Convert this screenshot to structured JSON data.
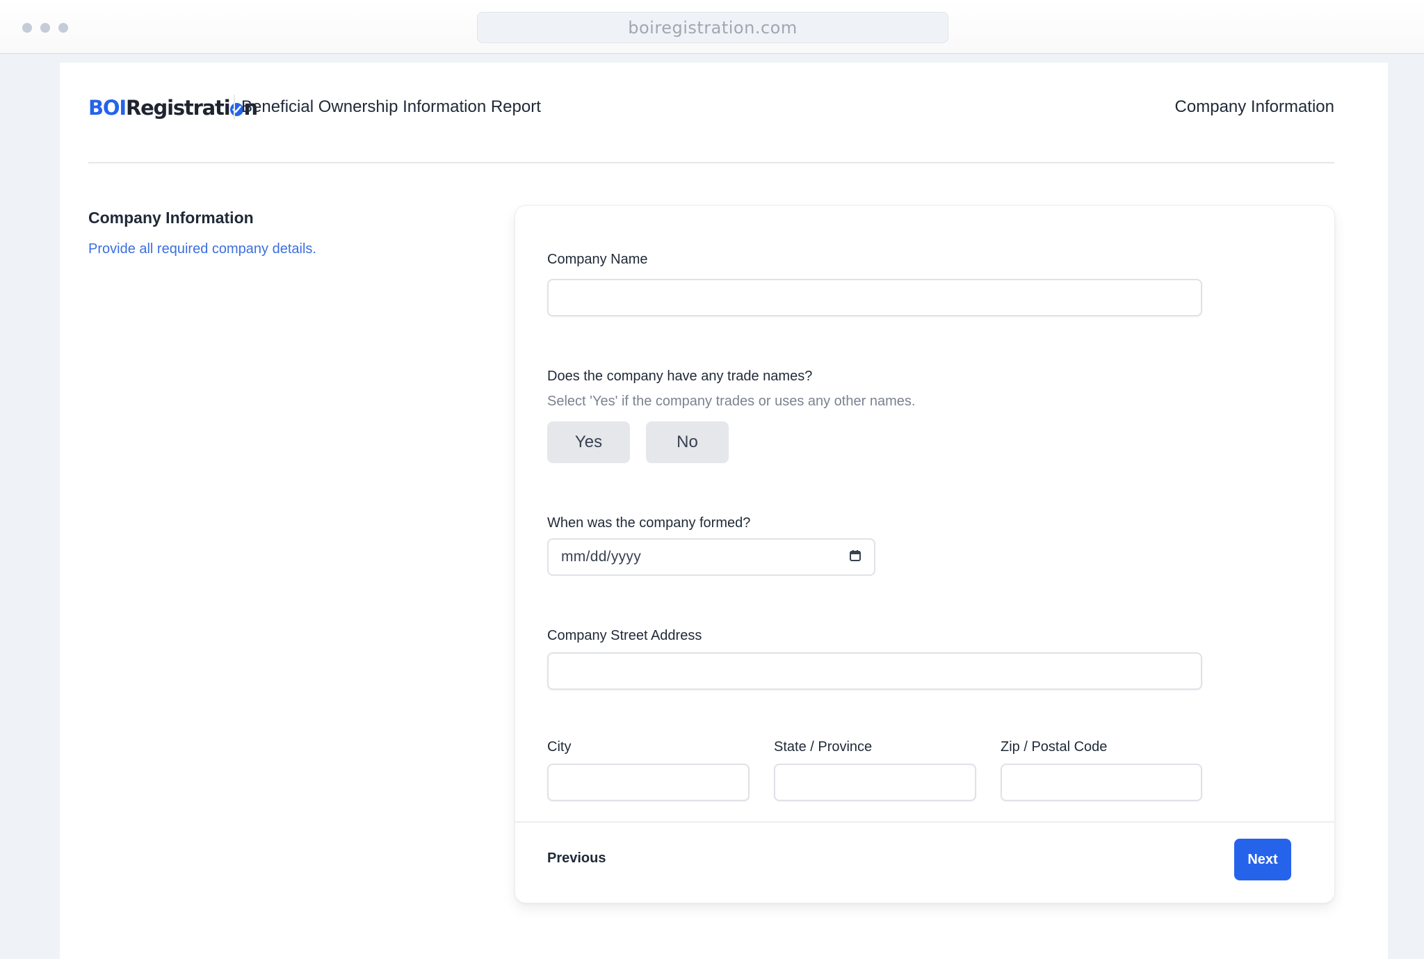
{
  "browser": {
    "url": "boiregistration.com"
  },
  "header": {
    "logo_part1": "BOI",
    "logo_part2": "Registrati",
    "logo_part3": "n",
    "report_title": "Beneficial Ownership Information Report",
    "step_label": "Company Information"
  },
  "sidebar": {
    "title": "Company Information",
    "description": "Provide all required company details."
  },
  "form": {
    "company_name": {
      "label": "Company Name",
      "value": ""
    },
    "trade_names": {
      "label": "Does the company have any trade names?",
      "hint": "Select 'Yes' if the company trades or uses any other names.",
      "options": [
        "Yes",
        "No"
      ]
    },
    "formation_date": {
      "label": "When was the company formed?",
      "placeholder": "mm/dd/yyyy",
      "icon": "calendar-icon"
    },
    "street_address": {
      "label": "Company Street Address",
      "value": ""
    },
    "city": {
      "label": "City",
      "value": ""
    },
    "state": {
      "label": "State / Province",
      "value": ""
    },
    "zip": {
      "label": "Zip / Postal Code",
      "value": ""
    }
  },
  "footer": {
    "previous_label": "Previous",
    "next_label": "Next"
  },
  "colors": {
    "accent": "#2563eb",
    "link": "#3b6fe0"
  }
}
